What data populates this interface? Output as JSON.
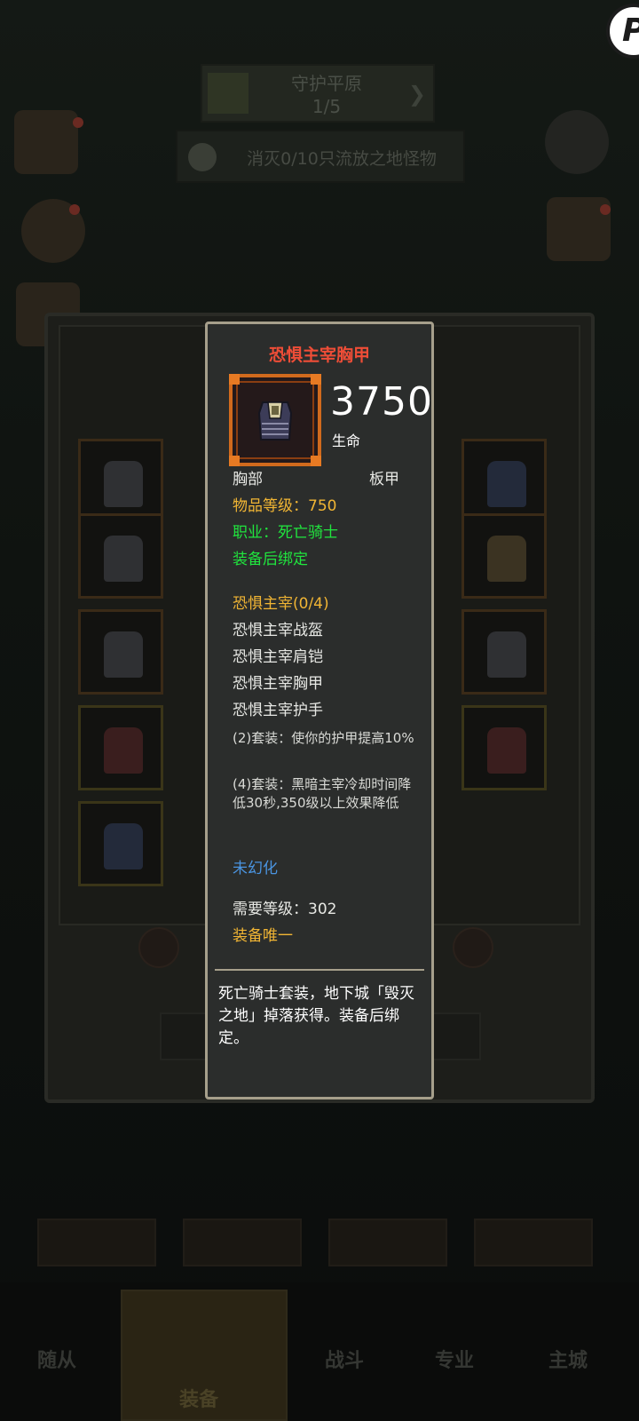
{
  "background": {
    "quest_title": "守护平原",
    "quest_progress": "1/5",
    "task_text": "消灭0/10只流放之地怪物",
    "bottom_tabs": [
      "随从",
      "装备",
      "战斗",
      "专业",
      "主城"
    ]
  },
  "tooltip": {
    "item_name": "恐惧主宰胸甲",
    "stat_value": "3750",
    "stat_label": "生命",
    "slot_type": "胸部",
    "armor_type": "板甲",
    "item_level": "物品等级：750",
    "class_req": "职业：死亡骑士",
    "bind": "装备后绑定",
    "set_name": "恐惧主宰(0/4)",
    "set_items": [
      "恐惧主宰战盔",
      "恐惧主宰肩铠",
      "恐惧主宰胸甲",
      "恐惧主宰护手"
    ],
    "set_bonus_2": "(2)套装：使你的护甲提高10%",
    "set_bonus_4": "(4)套装：黑暗主宰冷却时间降低30秒,350级以上效果降低",
    "transmog": "未幻化",
    "req_level": "需要等级：302",
    "unique": "装备唯一",
    "description": "死亡骑士套装，地下城「毁灭之地」掉落获得。装备后绑定。"
  },
  "colors": {
    "legendary_orange": "#d16a1d",
    "title_red": "#ee4d37",
    "gold": "#f1b534",
    "green": "#20e53e",
    "blue": "#4a94e0"
  }
}
